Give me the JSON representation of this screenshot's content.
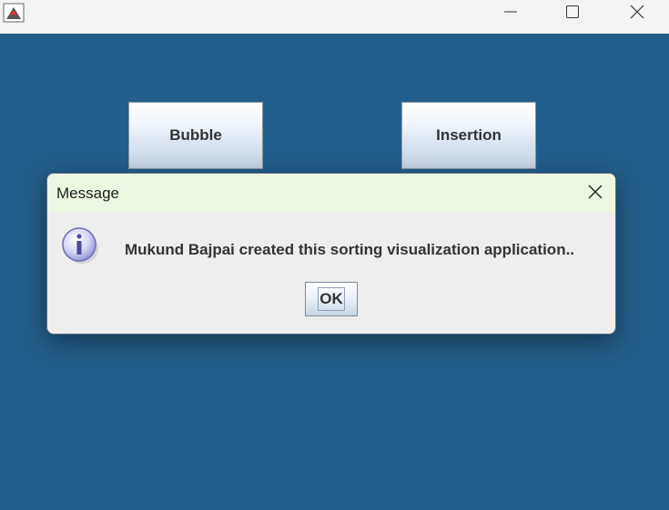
{
  "window": {
    "icons": {
      "app": "java-app-icon",
      "minimize": "minimize-icon",
      "maximize": "maximize-icon",
      "close": "close-icon"
    }
  },
  "main": {
    "buttons": [
      {
        "label": "Bubble"
      },
      {
        "label": "Insertion"
      }
    ],
    "background_color": "#235f8c"
  },
  "dialog": {
    "title": "Message",
    "message": "Mukund Bajpai created this sorting visualization application..",
    "ok_label": "OK",
    "icons": {
      "info": "info-icon",
      "close": "close-icon"
    },
    "title_bar_color": "#ebf7e1"
  }
}
